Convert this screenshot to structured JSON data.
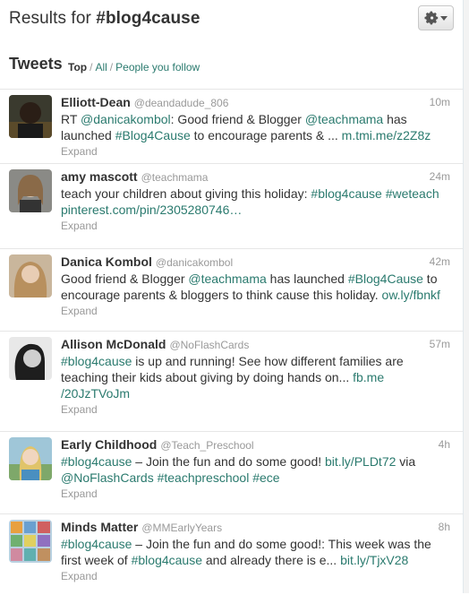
{
  "header": {
    "prefix": "Results for ",
    "query": "#blog4cause"
  },
  "subhead": {
    "title": "Tweets",
    "filter_top": "Top",
    "filter_all": "All",
    "filter_people": "People you follow",
    "sep": "/"
  },
  "expand_label": "Expand",
  "link_color": "#2a7a6e",
  "tweets": [
    {
      "name": "Elliott-Dean",
      "handle": "@deandadude_806",
      "time": "10m",
      "parts": [
        {
          "t": "RT "
        },
        {
          "l": "@danicakombol"
        },
        {
          "t": ": Good friend & Blogger "
        },
        {
          "l": "@teachmama"
        },
        {
          "t": " has launched "
        },
        {
          "l": "#Blog4Cause"
        },
        {
          "t": " to encourage parents & ... "
        },
        {
          "l": "m.tmi.me/z2Z8z"
        }
      ]
    },
    {
      "name": "amy mascott",
      "handle": "@teachmama",
      "time": "24m",
      "parts": [
        {
          "t": "teach your children about giving this holiday: "
        },
        {
          "l": "#blog4cause"
        },
        {
          "t": " "
        },
        {
          "l": "#weteach"
        },
        {
          "t": " "
        },
        {
          "l": "pinterest.com/pin/2305280746…"
        }
      ]
    },
    {
      "name": "Danica Kombol",
      "handle": "@danicakombol",
      "time": "42m",
      "parts": [
        {
          "t": "Good friend & Blogger "
        },
        {
          "l": "@teachmama"
        },
        {
          "t": " has launched "
        },
        {
          "l": "#Blog4Cause"
        },
        {
          "t": " to encourage parents & bloggers to think cause this holiday. "
        },
        {
          "l": "ow.ly/fbnkf"
        }
      ]
    },
    {
      "name": "Allison McDonald",
      "handle": "@NoFlashCards",
      "time": "57m",
      "parts": [
        {
          "l": "#blog4cause"
        },
        {
          "t": " is up and running! See how different families are teaching their kids about giving by doing hands on... "
        },
        {
          "l": "fb.me /20JzTVoJm"
        }
      ]
    },
    {
      "name": "Early Childhood",
      "handle": "@Teach_Preschool",
      "time": "4h",
      "parts": [
        {
          "l": "#blog4cause"
        },
        {
          "t": " – Join the fun and do some good! "
        },
        {
          "l": "bit.ly/PLDt72"
        },
        {
          "t": " via "
        },
        {
          "l": "@NoFlashCards"
        },
        {
          "t": " "
        },
        {
          "l": "#teachpreschool"
        },
        {
          "t": " "
        },
        {
          "l": "#ece"
        }
      ]
    },
    {
      "name": "Minds Matter",
      "handle": "@MMEarlyYears",
      "time": "8h",
      "parts": [
        {
          "l": "#blog4cause"
        },
        {
          "t": " – Join the fun and do some good!: This week was the first week of "
        },
        {
          "l": "#blog4cause"
        },
        {
          "t": " and already there is e... "
        },
        {
          "l": "bit.ly/TjxV28"
        }
      ]
    }
  ]
}
